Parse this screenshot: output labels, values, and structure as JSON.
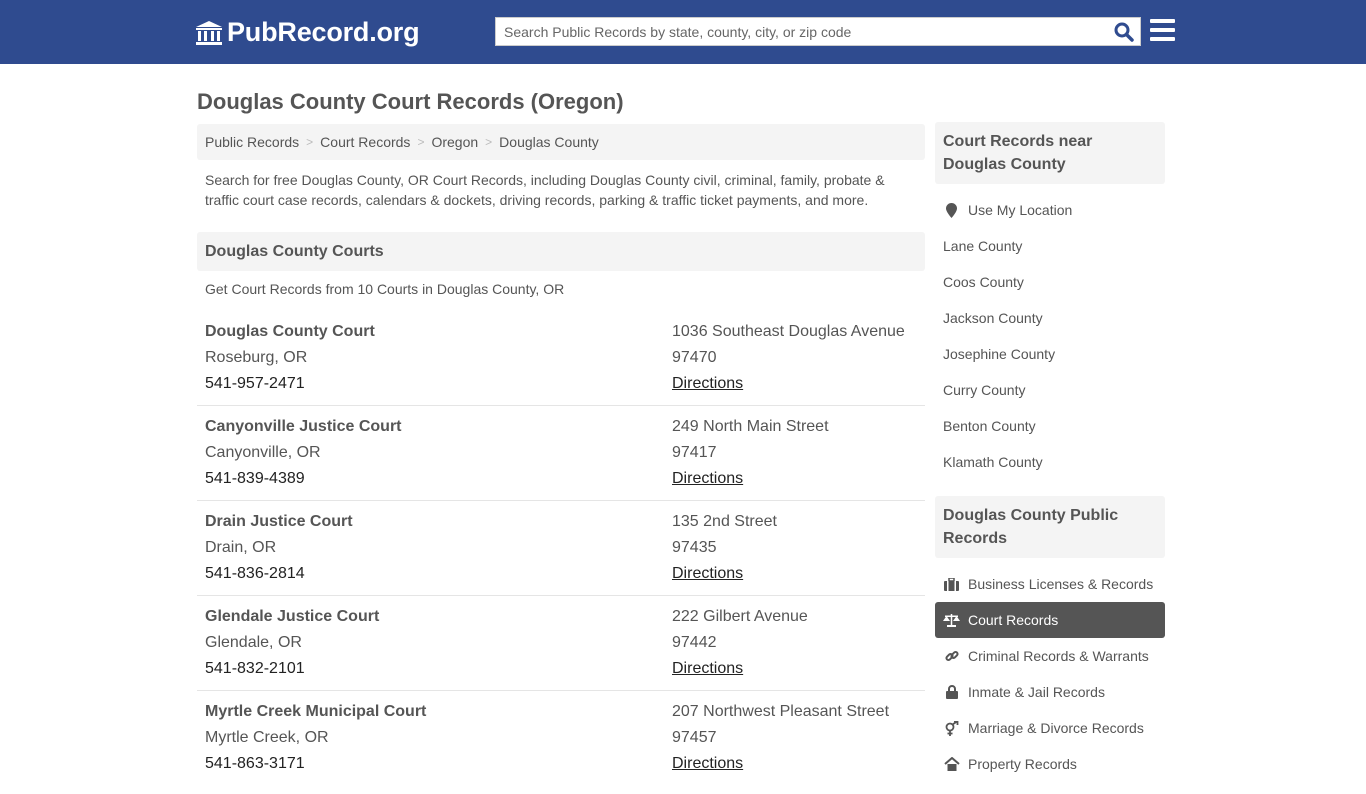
{
  "header": {
    "logo_text": "PubRecord.org",
    "search_placeholder": "Search Public Records by state, county, city, or zip code"
  },
  "colors": {
    "header_bg": "#2f4b8f",
    "search_icon": "#2f4b8f",
    "active_item_bg": "#555555"
  },
  "page": {
    "title": "Douglas County Court Records (Oregon)",
    "breadcrumb": [
      {
        "label": "Public Records"
      },
      {
        "label": "Court Records"
      },
      {
        "label": "Oregon"
      },
      {
        "label": "Douglas County"
      }
    ],
    "intro": "Search for free Douglas County, OR Court Records, including Douglas County civil, criminal, family, probate & traffic court case records, calendars & dockets, driving records, parking & traffic ticket payments, and more."
  },
  "courts_section": {
    "heading": "Douglas County Courts",
    "subheading": "Get Court Records from 10 Courts in Douglas County, OR",
    "directions_label": "Directions",
    "courts": [
      {
        "name": "Douglas County Court",
        "city": "Roseburg, OR",
        "phone": "541-957-2471",
        "address": "1036 Southeast Douglas Avenue",
        "zip": "97470",
        "directions": "Directions"
      },
      {
        "name": "Canyonville Justice Court",
        "city": "Canyonville, OR",
        "phone": "541-839-4389",
        "address": "249 North Main Street",
        "zip": "97417",
        "directions": "Directions"
      },
      {
        "name": "Drain Justice Court",
        "city": "Drain, OR",
        "phone": "541-836-2814",
        "address": "135 2nd Street",
        "zip": "97435",
        "directions": "Directions"
      },
      {
        "name": "Glendale Justice Court",
        "city": "Glendale, OR",
        "phone": "541-832-2101",
        "address": "222 Gilbert Avenue",
        "zip": "97442",
        "directions": "Directions"
      },
      {
        "name": "Myrtle Creek Municipal Court",
        "city": "Myrtle Creek, OR",
        "phone": "541-863-3171",
        "address": "207 Northwest Pleasant Street",
        "zip": "97457",
        "directions": "Directions"
      }
    ]
  },
  "sidebar": {
    "nearby_heading": "Court Records near Douglas County",
    "use_location": {
      "label": "Use My Location",
      "icon": "map-marker-icon"
    },
    "nearby": [
      {
        "label": "Lane County"
      },
      {
        "label": "Coos County"
      },
      {
        "label": "Jackson County"
      },
      {
        "label": "Josephine County"
      },
      {
        "label": "Curry County"
      },
      {
        "label": "Benton County"
      },
      {
        "label": "Klamath County"
      }
    ],
    "public_heading": "Douglas County Public Records",
    "public_records": [
      {
        "label": "Business Licenses & Records",
        "icon": "briefcase-icon",
        "active": false
      },
      {
        "label": "Court Records",
        "icon": "balance-scale-icon",
        "active": true
      },
      {
        "label": "Criminal Records & Warrants",
        "icon": "link-icon",
        "active": false
      },
      {
        "label": "Inmate & Jail Records",
        "icon": "lock-icon",
        "active": false
      },
      {
        "label": "Marriage & Divorce Records",
        "icon": "venus-mars-icon",
        "active": false
      },
      {
        "label": "Property Records",
        "icon": "home-icon",
        "active": false
      }
    ]
  }
}
